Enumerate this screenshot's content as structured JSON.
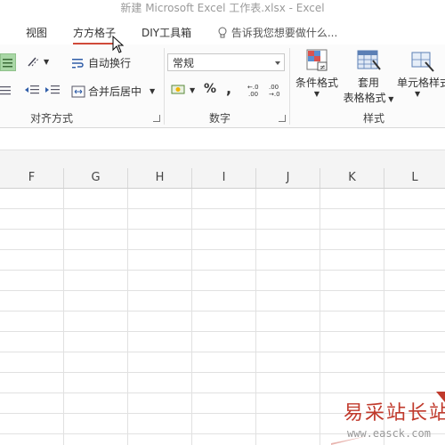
{
  "window": {
    "title": "新建 Microsoft Excel 工作表.xlsx - Excel"
  },
  "tabs": [
    {
      "label": "视图"
    },
    {
      "label": "方方格子"
    },
    {
      "label": "DIY工具箱"
    }
  ],
  "tell_me": {
    "text": "告诉我您想要做什么..."
  },
  "ribbon": {
    "alignment": {
      "wrap_text": "自动换行",
      "merge_center": "合并后居中",
      "group_label": "对齐方式"
    },
    "number": {
      "format_value": "常规",
      "percent": "%",
      "comma": ",",
      "group_label": "数字"
    },
    "styles": {
      "conditional": "条件格式",
      "table_line1": "套用",
      "table_line2": "表格格式",
      "cell_styles": "单元格样式",
      "group_label": "样式"
    }
  },
  "columns": [
    "F",
    "G",
    "H",
    "I",
    "J",
    "K",
    "L"
  ],
  "watermark": {
    "cn": "易采站长站",
    "url": "www.easck.com"
  },
  "colors": {
    "accent_green": "#a9d7a6",
    "underline_red": "#d04a3a",
    "watermark_red": "#c0392b"
  }
}
